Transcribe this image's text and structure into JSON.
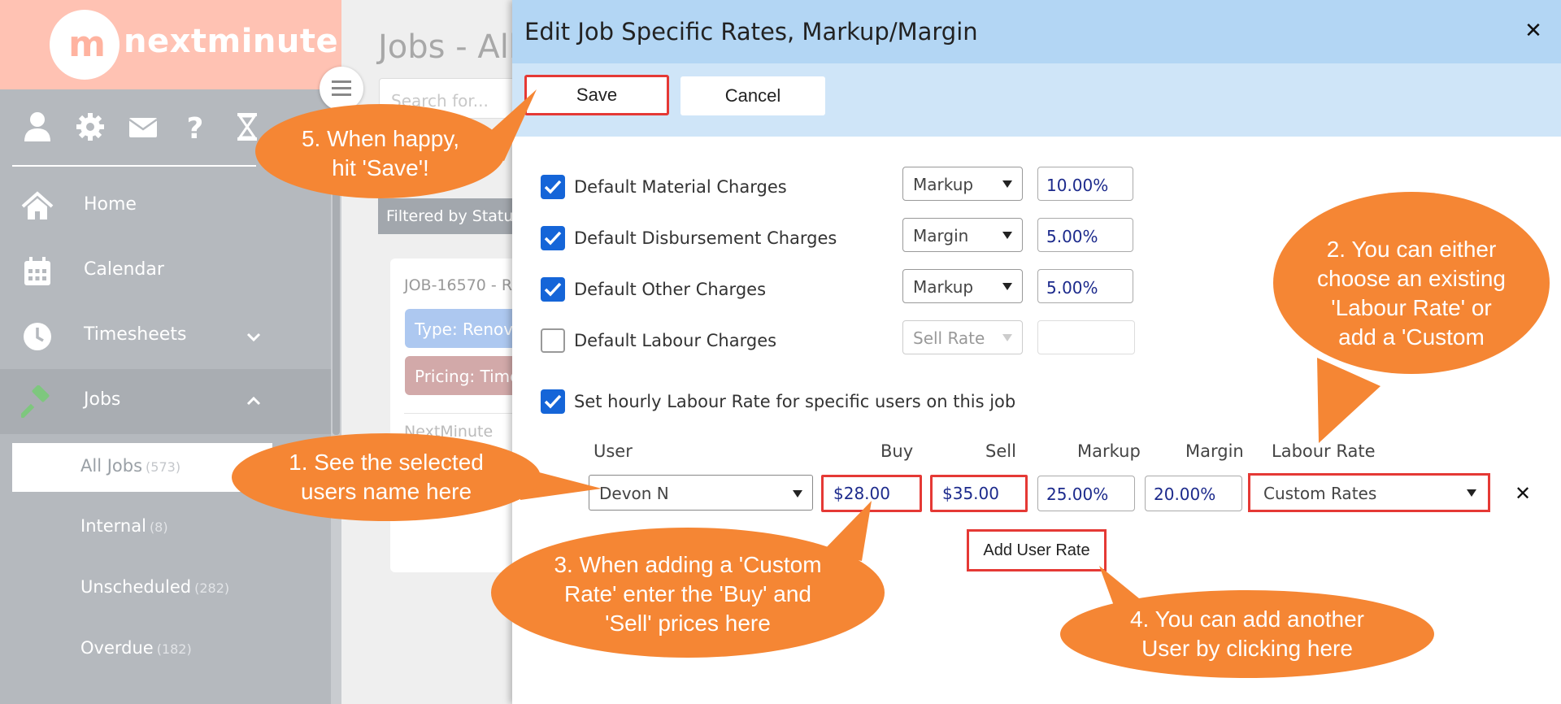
{
  "app": {
    "logo_text": "nextminute",
    "logo_mark": "m"
  },
  "sidebar": {
    "top_icons": [
      "user-icon",
      "gear-icon",
      "envelope-icon",
      "question-icon",
      "hourglass-icon"
    ],
    "nav": [
      {
        "label": "Home",
        "icon": "home-icon"
      },
      {
        "label": "Calendar",
        "icon": "calendar-icon"
      },
      {
        "label": "Timesheets",
        "icon": "clock-icon",
        "chevron": "chevron-down-icon"
      },
      {
        "label": "Jobs",
        "icon": "hammer-icon",
        "chevron": "chevron-up-icon"
      }
    ],
    "jobs_sub": [
      {
        "label": "All Jobs",
        "count": "(573)"
      },
      {
        "label": "Internal",
        "count": "(8)"
      },
      {
        "label": "Unscheduled",
        "count": "(282)"
      },
      {
        "label": "Overdue",
        "count": "(182)"
      }
    ]
  },
  "background": {
    "title": "Jobs - All",
    "search_placeholder": "Search for...",
    "filter_text": "Filtered by Statu",
    "card": {
      "job_id": "JOB-16570 - R",
      "type_pill": "Type: Renova",
      "pricing_pill": "Pricing: Time",
      "company": "NextMinute"
    }
  },
  "modal": {
    "title": "Edit Job Specific Rates, Markup/Margin",
    "close_icon": "close-icon",
    "save_label": "Save",
    "cancel_label": "Cancel",
    "charges": [
      {
        "label": "Default Material Charges",
        "checked": true,
        "mode": "Markup",
        "value": "10.00%"
      },
      {
        "label": "Default Disbursement Charges",
        "checked": true,
        "mode": "Margin",
        "value": "5.00%"
      },
      {
        "label": "Default Other Charges",
        "checked": true,
        "mode": "Markup",
        "value": "5.00%"
      },
      {
        "label": "Default Labour Charges",
        "checked": false,
        "mode": "Sell Rate",
        "value": ""
      }
    ],
    "user_rate_toggle": {
      "label": "Set hourly Labour Rate for specific users on this job",
      "checked": true
    },
    "user_table": {
      "headers": {
        "user": "User",
        "buy": "Buy",
        "sell": "Sell",
        "markup": "Markup",
        "margin": "Margin",
        "labour_rate": "Labour Rate"
      },
      "rows": [
        {
          "user": "Devon N",
          "buy": "$28.00",
          "sell": "$35.00",
          "markup": "25.00%",
          "margin": "20.00%",
          "labour_rate": "Custom Rates"
        }
      ]
    },
    "add_user_rate_label": "Add User Rate"
  },
  "callouts": {
    "color": "#f58634",
    "highlight_color": "#e53935",
    "c1": [
      "1. See the selected",
      "users name here"
    ],
    "c2": [
      "2. You can either",
      "choose an existing",
      "'Labour Rate' or",
      "add a 'Custom"
    ],
    "c3": [
      "3. When adding a 'Custom",
      "Rate' enter the 'Buy' and",
      "'Sell' prices here"
    ],
    "c4": [
      "4. You can add another",
      "User by clicking here"
    ],
    "c5": [
      "5. When happy,",
      "hit 'Save'!"
    ]
  }
}
